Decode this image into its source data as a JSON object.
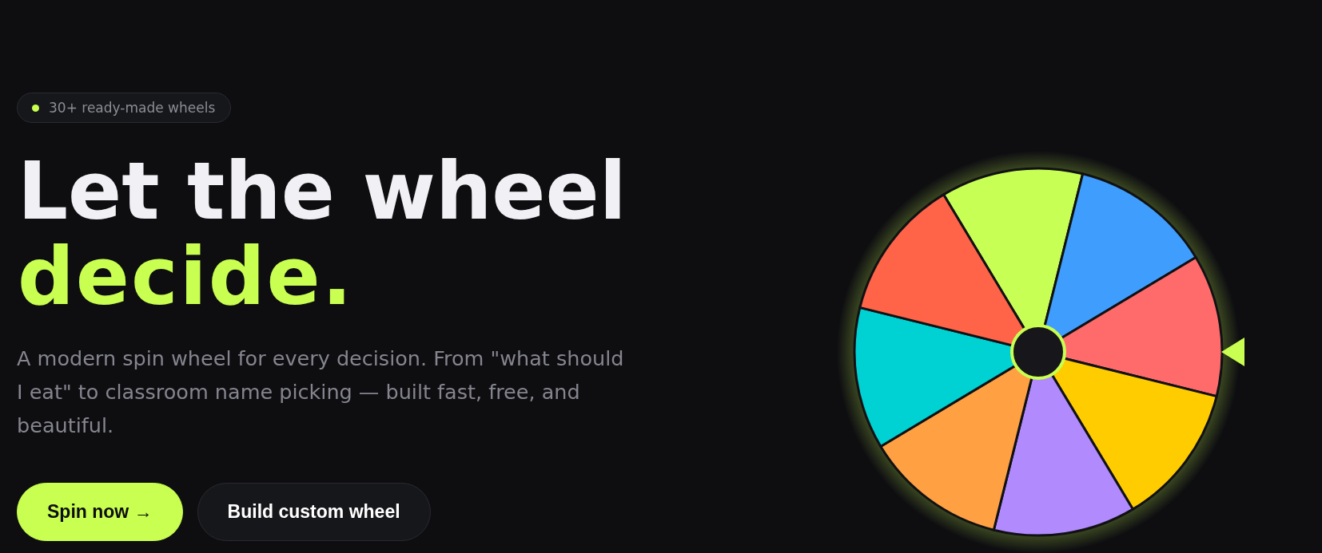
{
  "badge": {
    "text": "30+ ready-made wheels"
  },
  "headline": {
    "text": "Let the wheel",
    "highlight": "decide."
  },
  "description": "A modern spin wheel for every decision. From \"what should I eat\" to classroom name picking — built fast, free, and beautiful.",
  "buttons": [
    {
      "label": "Spin now →",
      "kind": "primary"
    },
    {
      "label": "Build custom wheel",
      "kind": "secondary"
    }
  ],
  "wheel": {
    "segments": [
      {
        "color": "#c8ff55"
      },
      {
        "color": "#3f9efd"
      },
      {
        "color": "#ff6b6b"
      },
      {
        "color": "#ffcc00"
      },
      {
        "color": "#b18afd"
      },
      {
        "color": "#ffa043"
      },
      {
        "color": "#00d2d3"
      },
      {
        "color": "#ff6449"
      }
    ]
  }
}
